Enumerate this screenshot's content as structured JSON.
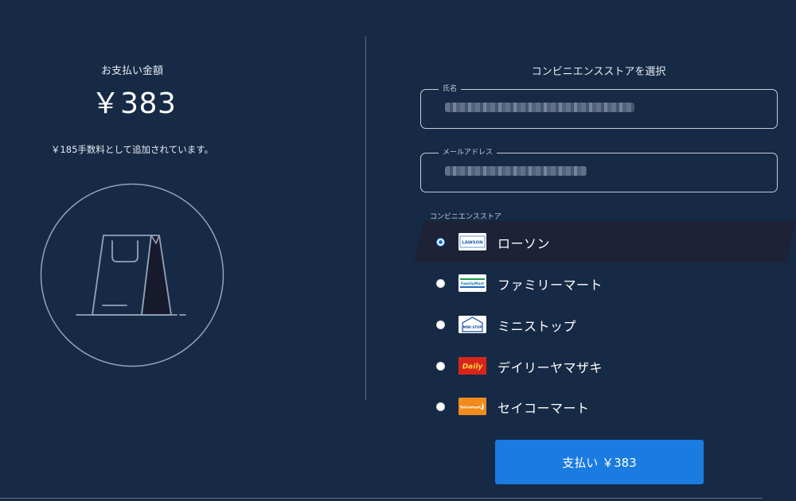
{
  "summary": {
    "amount_label": "お支払い金額",
    "amount": "￥383",
    "fee_note": "￥185手数料として追加されています。"
  },
  "form": {
    "title": "コンビニエンスストアを選択",
    "name_field": {
      "label": "氏名",
      "value": ""
    },
    "email_field": {
      "label": "メールアドレス",
      "value": ""
    },
    "stores_label": "コンビニエンスストア",
    "stores": [
      {
        "name": "ローソン",
        "logo_text": "LAWSON",
        "selected": true
      },
      {
        "name": "ファミリーマート",
        "logo_text": "FamilyMart",
        "selected": false
      },
      {
        "name": "ミニストップ",
        "logo_text": "MINI STOP",
        "selected": false
      },
      {
        "name": "デイリーヤマザキ",
        "logo_text": "Daily",
        "selected": false
      },
      {
        "name": "セイコーマート",
        "logo_text": "Seicomart",
        "selected": false
      }
    ]
  },
  "pay_button": {
    "label": "支払い ￥383"
  },
  "colors": {
    "background": "#172a45",
    "accent": "#1a7be0",
    "selected_row": "#1d2236",
    "divider": "#5e6f87"
  },
  "icons": {
    "illustration": "shopping-bag-icon"
  }
}
